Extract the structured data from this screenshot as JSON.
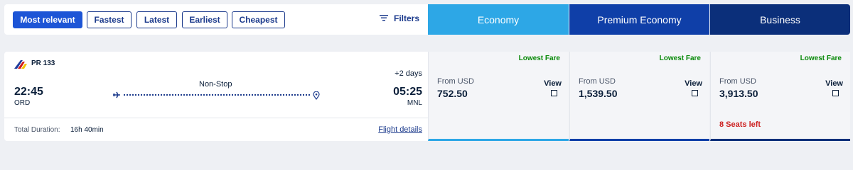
{
  "sort": {
    "options": [
      "Most relevant",
      "Fastest",
      "Latest",
      "Earliest",
      "Cheapest"
    ],
    "active": "Most relevant",
    "filters_label": "Filters"
  },
  "cabins": [
    "Economy",
    "Premium Economy",
    "Business"
  ],
  "flight": {
    "flight_number": "PR 133",
    "departure": {
      "time": "22:45",
      "code": "ORD"
    },
    "arrival": {
      "time": "05:25",
      "code": "MNL",
      "day_offset": "+2 days"
    },
    "stops": "Non-Stop",
    "total_duration_label": "Total Duration:",
    "total_duration_value": "16h 40min",
    "details_link": "Flight details"
  },
  "fares": [
    {
      "cabin": "Economy",
      "badge": "Lowest Fare",
      "from_label": "From USD",
      "price": "752.50",
      "view_label": "View",
      "seats_left": ""
    },
    {
      "cabin": "Premium Economy",
      "badge": "Lowest Fare",
      "from_label": "From USD",
      "price": "1,539.50",
      "view_label": "View",
      "seats_left": ""
    },
    {
      "cabin": "Business",
      "badge": "Lowest Fare",
      "from_label": "From USD",
      "price": "3,913.50",
      "view_label": "View",
      "seats_left": "8 Seats left"
    }
  ],
  "colors": {
    "accent_blue": "#1d55d6",
    "economy": "#2da7e6",
    "premium_economy": "#0f3fa8",
    "business": "#0b2f7a",
    "lowest_fare": "#0a8a0a",
    "seats_left": "#cc1f1f"
  },
  "icons": {
    "filters": "filter-lines-icon",
    "plane": "plane-icon",
    "destination": "map-pin-icon",
    "airline": "airline-logo"
  }
}
